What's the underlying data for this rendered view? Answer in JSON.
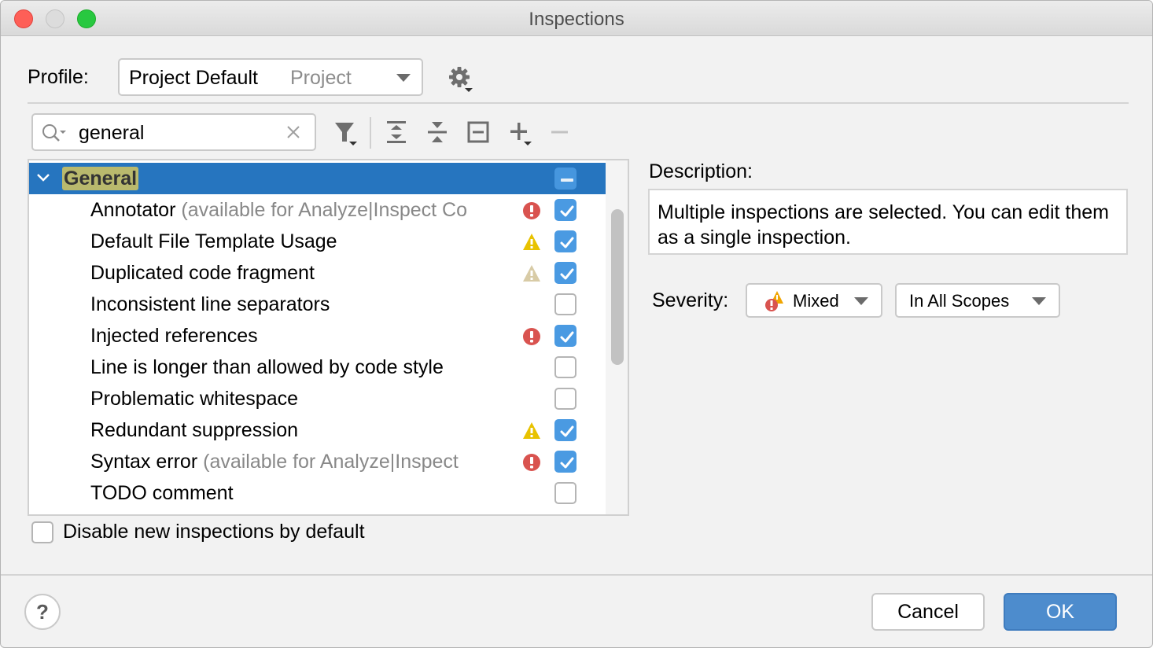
{
  "window": {
    "title": "Inspections",
    "controls": [
      "close",
      "minimize",
      "zoom"
    ]
  },
  "profile": {
    "label": "Profile:",
    "selected_name": "Project Default",
    "selected_scope": "Project",
    "settings_icon": "gear-icon"
  },
  "search": {
    "value": "general",
    "placeholder": ""
  },
  "toolbar": {
    "filter": "filter-icon",
    "expand_all": "expand-all-icon",
    "collapse_all": "collapse-all-icon",
    "reset": "reset-to-empty-icon",
    "add": "add-icon",
    "remove": "remove-icon"
  },
  "tree": {
    "group": {
      "label": "General",
      "expanded": true,
      "state": "mixed"
    },
    "items": [
      {
        "label": "Annotator",
        "hint": "(available for Analyze|Inspect Co",
        "severity": "error",
        "checked": true
      },
      {
        "label": "Default File Template Usage",
        "hint": "",
        "severity": "warning",
        "checked": true
      },
      {
        "label": "Duplicated code fragment",
        "hint": "",
        "severity": "weak-warning",
        "checked": true
      },
      {
        "label": "Inconsistent line separators",
        "hint": "",
        "severity": "",
        "checked": false
      },
      {
        "label": "Injected references",
        "hint": "",
        "severity": "error",
        "checked": true
      },
      {
        "label": "Line is longer than allowed by code style",
        "hint": "",
        "severity": "",
        "checked": false
      },
      {
        "label": "Problematic whitespace",
        "hint": "",
        "severity": "",
        "checked": false
      },
      {
        "label": "Redundant suppression",
        "hint": "",
        "severity": "warning",
        "checked": true
      },
      {
        "label": "Syntax error",
        "hint": "(available for Analyze|Inspect",
        "severity": "error",
        "checked": true
      },
      {
        "label": "TODO comment",
        "hint": "",
        "severity": "",
        "checked": false
      }
    ]
  },
  "disable_new": {
    "label": "Disable new inspections by default",
    "checked": false
  },
  "description": {
    "label": "Description:",
    "text": "Multiple inspections are selected. You can edit them as a single inspection."
  },
  "severity": {
    "label": "Severity:",
    "value": "Mixed",
    "scope": "In All Scopes"
  },
  "footer": {
    "help": "?",
    "cancel": "Cancel",
    "ok": "OK"
  },
  "colors": {
    "selection": "#2675bf",
    "checkbox": "#4a9ae2",
    "error": "#d9534f",
    "warning": "#e8c200",
    "weak_warning": "#d8cba6",
    "ok_button": "#4d8ccd",
    "search_highlight": "#b9b96d"
  }
}
